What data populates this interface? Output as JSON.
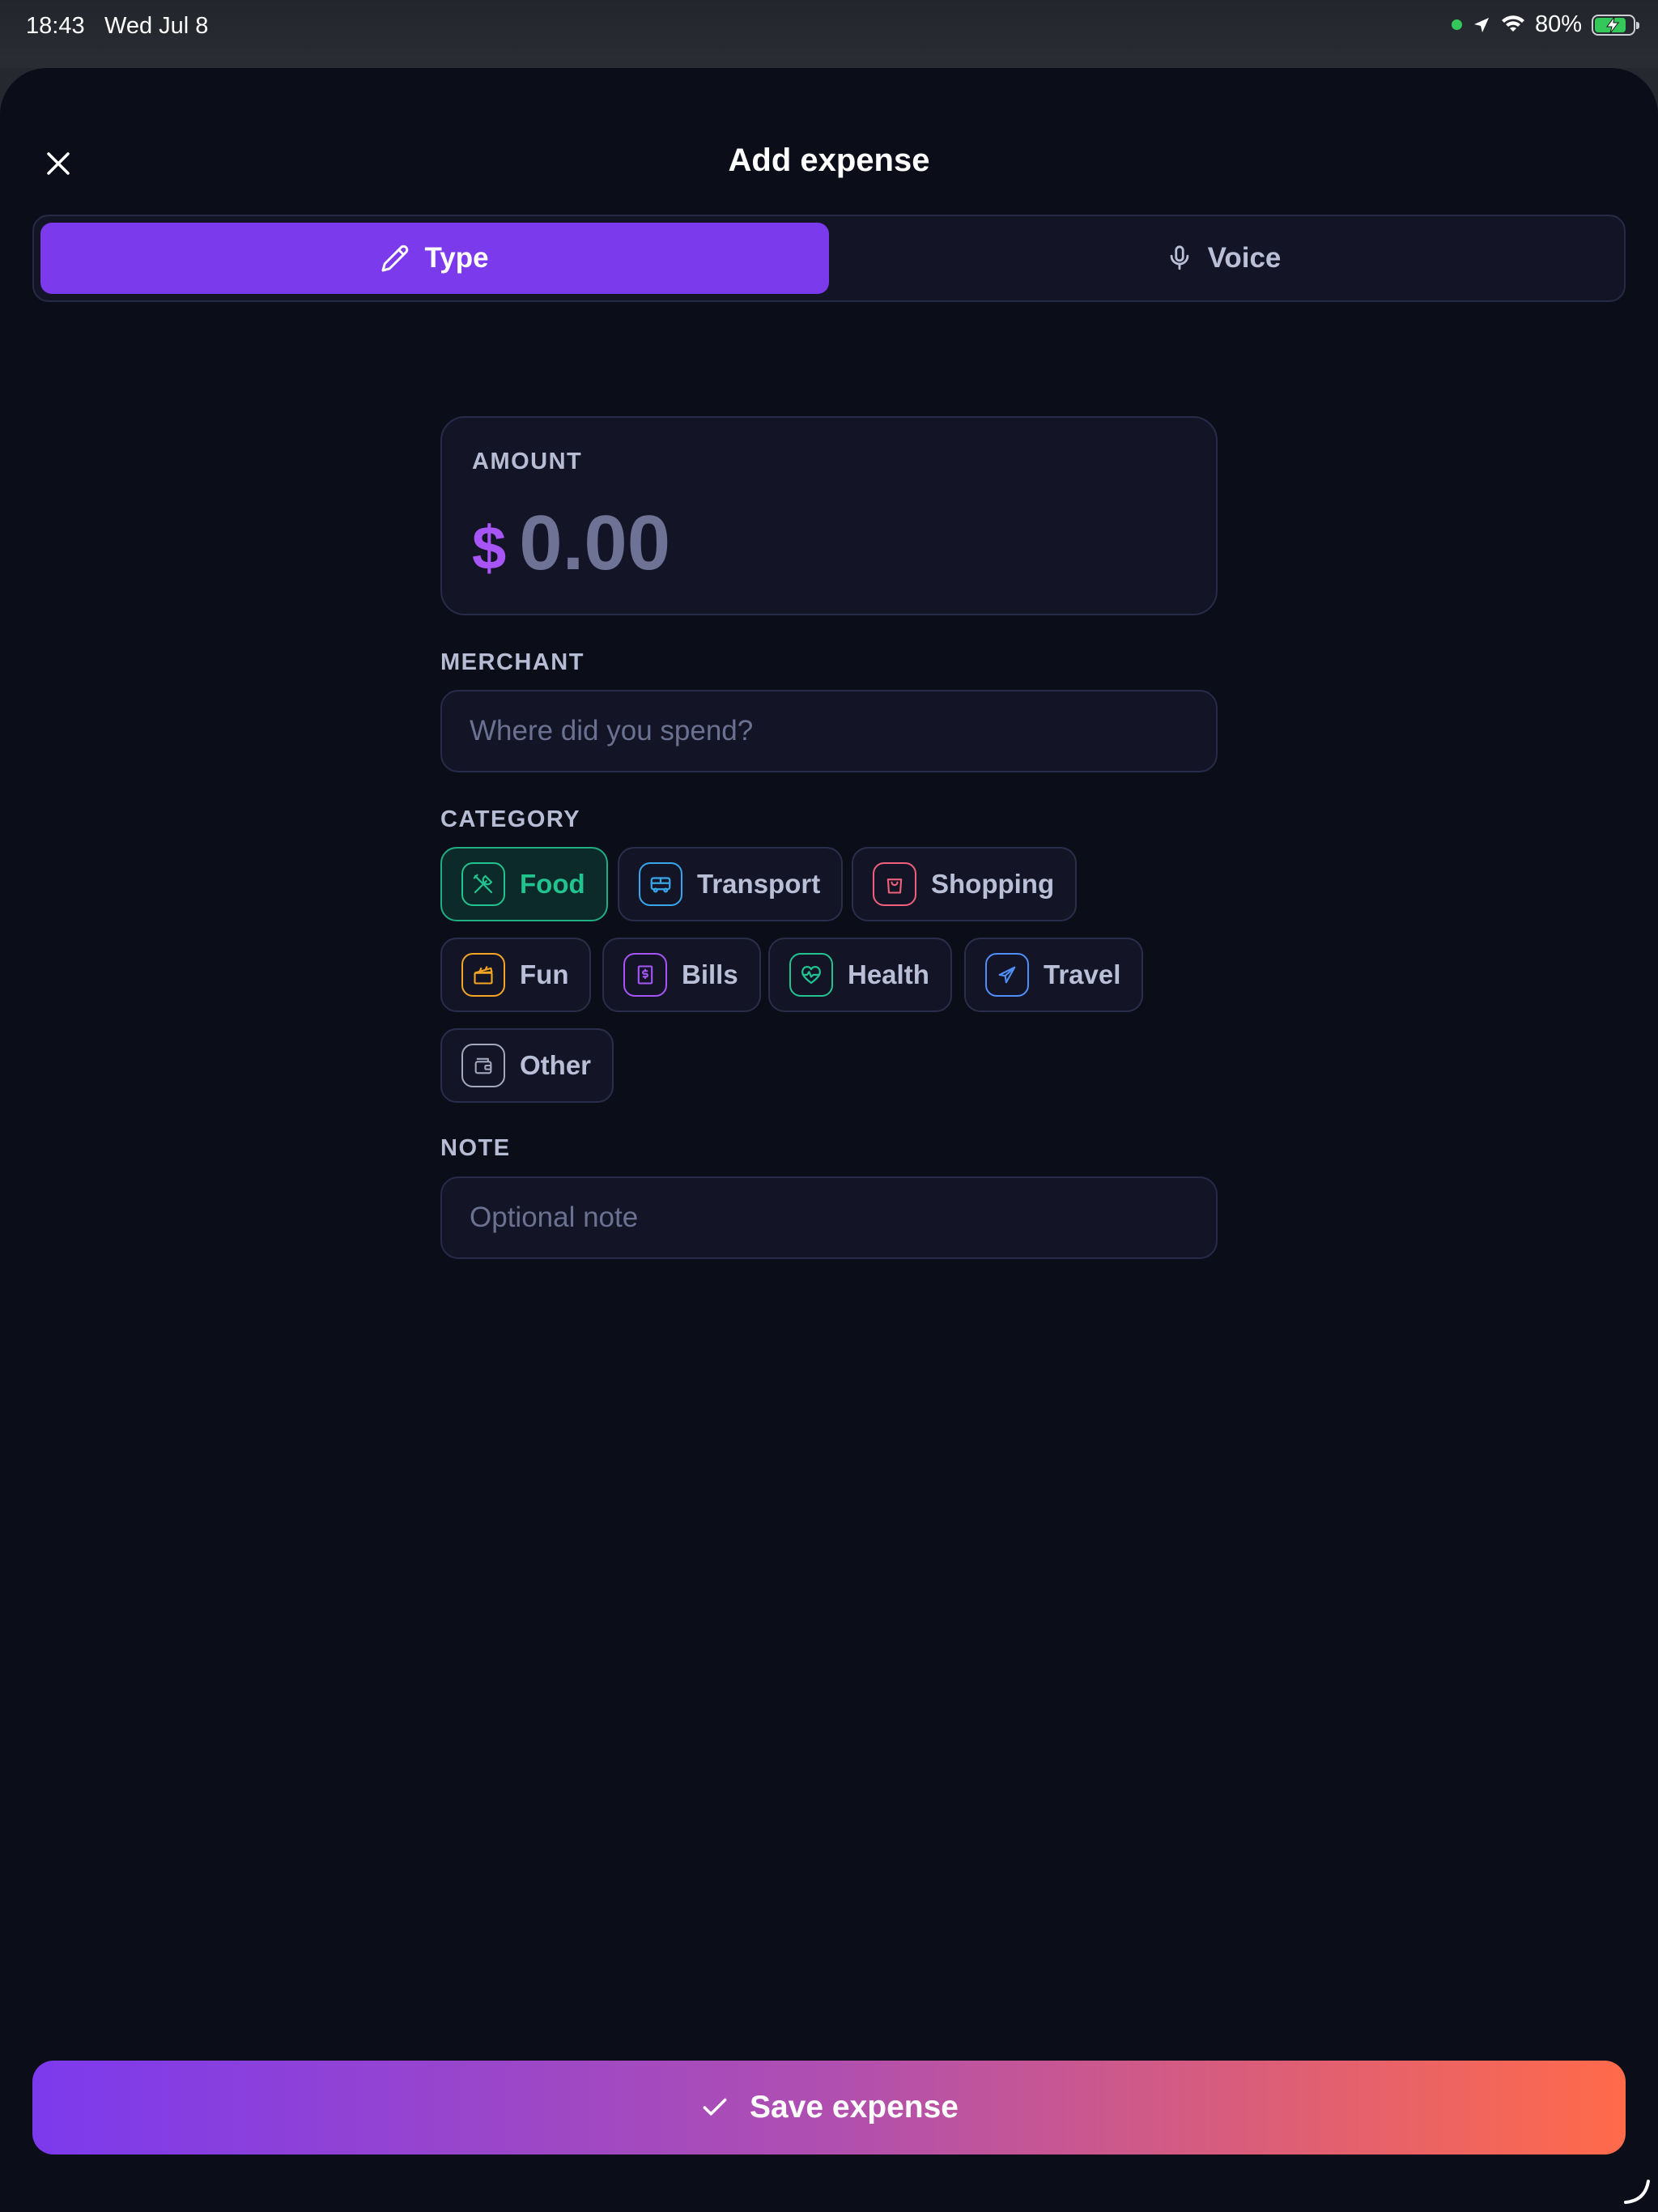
{
  "status_bar": {
    "time": "18:43",
    "date": "Wed Jul 8",
    "battery": "80%",
    "icons": [
      "green-dot-icon",
      "location-arrow-icon",
      "wifi-icon",
      "battery-charging-icon"
    ]
  },
  "header": {
    "title": "Add expense",
    "close_icon": "close-icon"
  },
  "mode_toggle": {
    "type_label": "Type",
    "voice_label": "Voice",
    "selected": "Type"
  },
  "amount": {
    "label": "AMOUNT",
    "currency": "$",
    "value": "0.00"
  },
  "merchant": {
    "label": "MERCHANT",
    "placeholder": "Where did you spend?",
    "value": ""
  },
  "category": {
    "label": "CATEGORY",
    "selected": "Food",
    "items": [
      {
        "label": "Food",
        "icon": "utensils-icon",
        "color": "#22c38e"
      },
      {
        "label": "Transport",
        "icon": "bus-icon",
        "color": "#38a6e8"
      },
      {
        "label": "Shopping",
        "icon": "shopping-bag-icon",
        "color": "#f0607a"
      },
      {
        "label": "Fun",
        "icon": "clapperboard-icon",
        "color": "#f5a524"
      },
      {
        "label": "Bills",
        "icon": "receipt-icon",
        "color": "#a855f7"
      },
      {
        "label": "Health",
        "icon": "heart-pulse-icon",
        "color": "#22c38e"
      },
      {
        "label": "Travel",
        "icon": "plane-icon",
        "color": "#4f8ff7"
      },
      {
        "label": "Other",
        "icon": "wallet-icon",
        "color": "#a3a8bd"
      }
    ]
  },
  "note": {
    "label": "NOTE",
    "placeholder": "Optional note",
    "value": ""
  },
  "save_button": {
    "label": "Save expense",
    "icon": "check-icon"
  },
  "colors": {
    "background": "#0b0d18",
    "card": "#131527",
    "accent": "#7c3aed",
    "gradient_end": "#ff6a4a"
  }
}
